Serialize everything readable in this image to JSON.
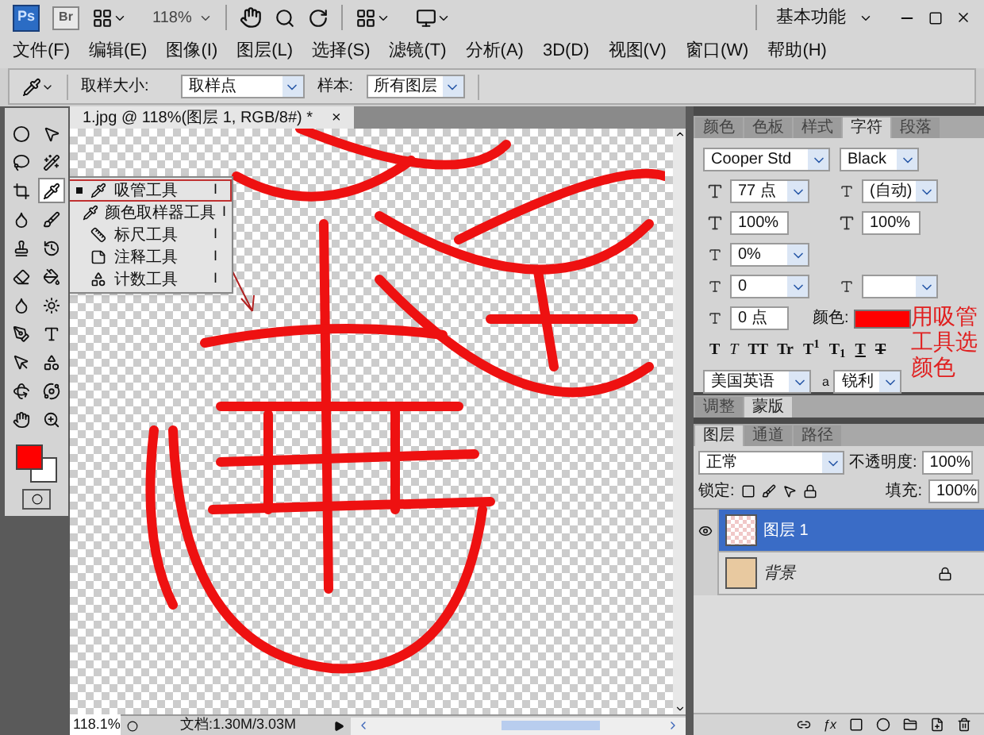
{
  "app_bar": {
    "ps_logo": "Ps",
    "br_logo": "Br",
    "zoom": "118%",
    "workspace": "基本功能"
  },
  "menu": [
    "文件(F)",
    "编辑(E)",
    "图像(I)",
    "图层(L)",
    "选择(S)",
    "滤镜(T)",
    "分析(A)",
    "3D(D)",
    "视图(V)",
    "窗口(W)",
    "帮助(H)"
  ],
  "options_bar": {
    "sample_size_label": "取样大小:",
    "sample_size": "取样点",
    "sample_label": "样本:",
    "sample": "所有图层"
  },
  "tools": [
    {
      "selected": false
    },
    {
      "selected": false
    },
    {
      "selected": false
    },
    {
      "selected": false
    },
    {
      "selected": false
    },
    {
      "selected": true
    },
    {
      "selected": false
    },
    {
      "selected": false
    },
    {
      "selected": false
    },
    {
      "selected": false
    },
    {
      "selected": false
    },
    {
      "selected": false
    },
    {
      "selected": false
    },
    {
      "selected": false
    },
    {
      "selected": false
    },
    {
      "selected": false
    },
    {
      "selected": false
    },
    {
      "selected": false
    },
    {
      "selected": false
    },
    {
      "selected": false
    },
    {
      "selected": false
    },
    {
      "selected": false
    }
  ],
  "document_tab": {
    "title": "1.jpg @ 118%(图层 1, RGB/8#) *",
    "close": "×"
  },
  "tool_flyout": [
    {
      "label": "吸管工具",
      "shortcut": "I",
      "selected": true
    },
    {
      "label": "颜色取样器工具",
      "shortcut": "I",
      "selected": false
    },
    {
      "label": "标尺工具",
      "shortcut": "I",
      "selected": false
    },
    {
      "label": "注释工具",
      "shortcut": "I",
      "selected": false
    },
    {
      "label": "计数工具",
      "shortcut": "I",
      "selected": false
    }
  ],
  "status_bar": {
    "zoom": "118.1%",
    "document": "文档:1.30M/3.03M"
  },
  "character_panel": {
    "tabs": [
      {
        "label": "颜色",
        "selected": false
      },
      {
        "label": "色板",
        "selected": false
      },
      {
        "label": "样式",
        "selected": false
      },
      {
        "label": "字符",
        "selected": true
      },
      {
        "label": "段落",
        "selected": false
      }
    ],
    "font": "Cooper Std",
    "style": "Black",
    "size": "77 点",
    "leading": "(自动)",
    "vertical_scale": "100%",
    "horizontal_scale": "100%",
    "tracking": "0%",
    "kerning": "0",
    "baseline": "0 点",
    "color_label": "颜色:",
    "style_buttons": [
      {
        "label": "T",
        "kind": "bold"
      },
      {
        "label": "T",
        "kind": "italic"
      },
      {
        "label": "TT",
        "kind": "caps"
      },
      {
        "label": "Tr",
        "kind": "smallcaps"
      },
      {
        "label": "T$^{1}$",
        "kind": "super"
      },
      {
        "label": "T$_{1}$",
        "kind": "sub"
      },
      {
        "label": "T",
        "kind": "underline"
      },
      {
        "label": "T",
        "kind": "strike"
      }
    ],
    "language": "美国英语",
    "anti_alias_icon": "a",
    "anti_alias": "锐利"
  },
  "annotation": "用吸管工具选颜色",
  "adjust_panel": {
    "tabs": [
      {
        "label": "调整",
        "selected": false
      },
      {
        "label": "蒙版",
        "selected": true
      }
    ]
  },
  "layers_panel": {
    "tabs": [
      {
        "label": "图层",
        "selected": true
      },
      {
        "label": "通道",
        "selected": false
      },
      {
        "label": "路径",
        "selected": false
      }
    ],
    "fx_button": "ƒx",
    "blend_mode": "正常",
    "opacity_label": "不透明度:",
    "opacity": "100%",
    "lock_label": "锁定:",
    "fill_label": "填充:",
    "fill": "100%",
    "layers": [
      {
        "name": "图层 1",
        "selected": true,
        "visible": true,
        "locked": false,
        "kind": "transparent"
      },
      {
        "name": "背景",
        "selected": false,
        "visible": false,
        "locked": true
      }
    ]
  }
}
